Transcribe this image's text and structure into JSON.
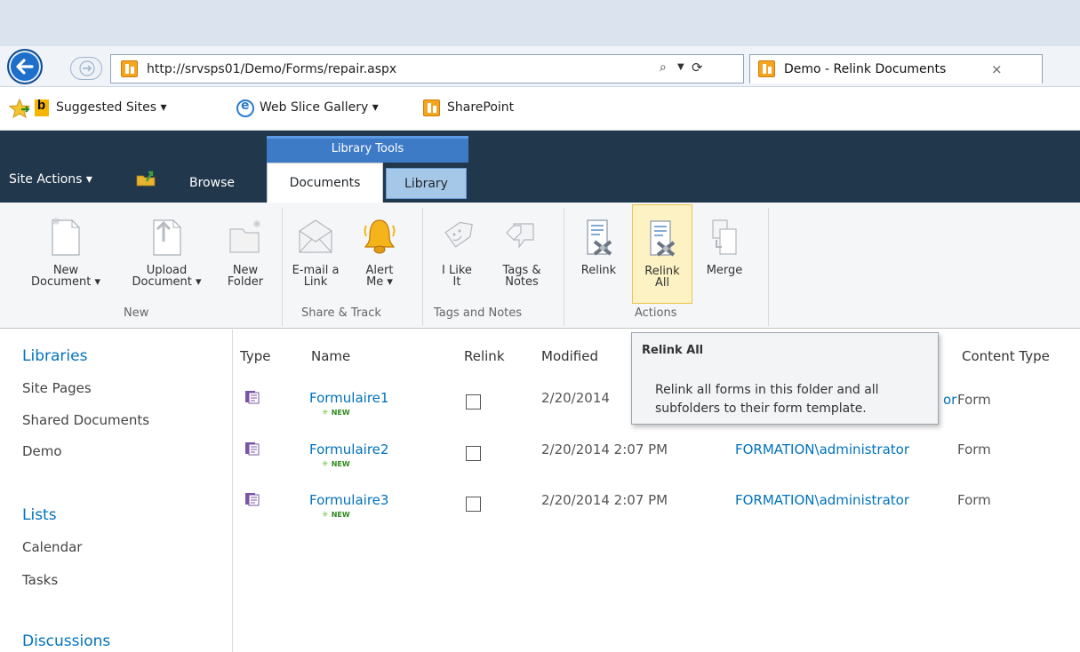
{
  "browser": {
    "address": "http://srvsps01/Demo/Forms/repair.aspx",
    "tab_title": "Demo - Relink Documents",
    "tab_close": "×",
    "search_glyph": "⌕",
    "refresh_glyph": "⟳",
    "favorites": [
      {
        "label": "Suggested Sites ▾"
      },
      {
        "label": "Web Slice Gallery ▾"
      },
      {
        "label": "SharePoint"
      }
    ]
  },
  "sharepoint": {
    "site_actions": "Site Actions ▾",
    "tab_browse": "Browse",
    "context_header": "Library Tools",
    "tab_documents": "Documents",
    "tab_library": "Library",
    "ribbon": {
      "groups": [
        {
          "label": "New"
        },
        {
          "label": "Share & Track"
        },
        {
          "label": "Tags and Notes"
        },
        {
          "label": "Actions"
        }
      ],
      "buttons": {
        "new_document": [
          "New",
          "Document ▾"
        ],
        "upload_document": [
          "Upload",
          "Document ▾"
        ],
        "new_folder": [
          "New",
          "Folder"
        ],
        "email_link": [
          "E-mail a",
          "Link"
        ],
        "alert_me": [
          "Alert",
          "Me ▾"
        ],
        "i_like_it": [
          "I Like",
          "It"
        ],
        "tags_notes": [
          "Tags &",
          "Notes"
        ],
        "relink": [
          "Relink"
        ],
        "relink_all": [
          "Relink",
          "All"
        ],
        "merge": [
          "Merge"
        ]
      }
    },
    "quicklaunch": {
      "libraries_heading": "Libraries",
      "libraries": [
        "Site Pages",
        "Shared Documents",
        "Demo"
      ],
      "lists_heading": "Lists",
      "lists": [
        "Calendar",
        "Tasks"
      ],
      "discussions_heading": "Discussions"
    },
    "columns": [
      "Type",
      "Name",
      "Relink",
      "Modified",
      "Content Type"
    ],
    "documents": [
      {
        "name": "Formulaire1",
        "badge": "NEW",
        "modified": "2/20/2014",
        "modified_by": "or",
        "content_type": "Form"
      },
      {
        "name": "Formulaire2",
        "badge": "NEW",
        "modified": "2/20/2014 2:07 PM",
        "modified_by": "FORMATION\\administrator",
        "content_type": "Form"
      },
      {
        "name": "Formulaire3",
        "badge": "NEW",
        "modified": "2/20/2014 2:07 PM",
        "modified_by": "FORMATION\\administrator",
        "content_type": "Form"
      }
    ],
    "tooltip": {
      "title": "Relink All",
      "body": "Relink all forms in this folder and all subfolders to their form template."
    }
  }
}
